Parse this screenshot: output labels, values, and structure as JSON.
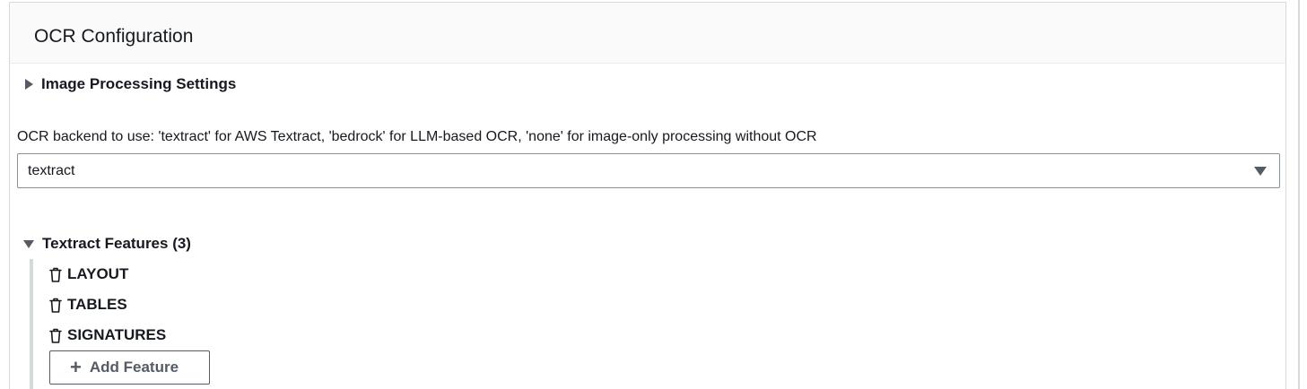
{
  "container": {
    "title": "OCR Configuration"
  },
  "image_processing": {
    "label": "Image Processing Settings",
    "expanded": false
  },
  "ocr_backend": {
    "label": "OCR backend to use: 'textract' for AWS Textract, 'bedrock' for LLM-based OCR, 'none' for image-only processing without OCR",
    "selected": "textract"
  },
  "textract_features": {
    "label": "Textract Features (3)",
    "expanded": true,
    "items": [
      {
        "label": "LAYOUT",
        "icon": "trash-icon"
      },
      {
        "label": "TABLES",
        "icon": "trash-icon"
      },
      {
        "label": "SIGNATURES",
        "icon": "trash-icon"
      }
    ],
    "add_label": "Add Feature"
  }
}
